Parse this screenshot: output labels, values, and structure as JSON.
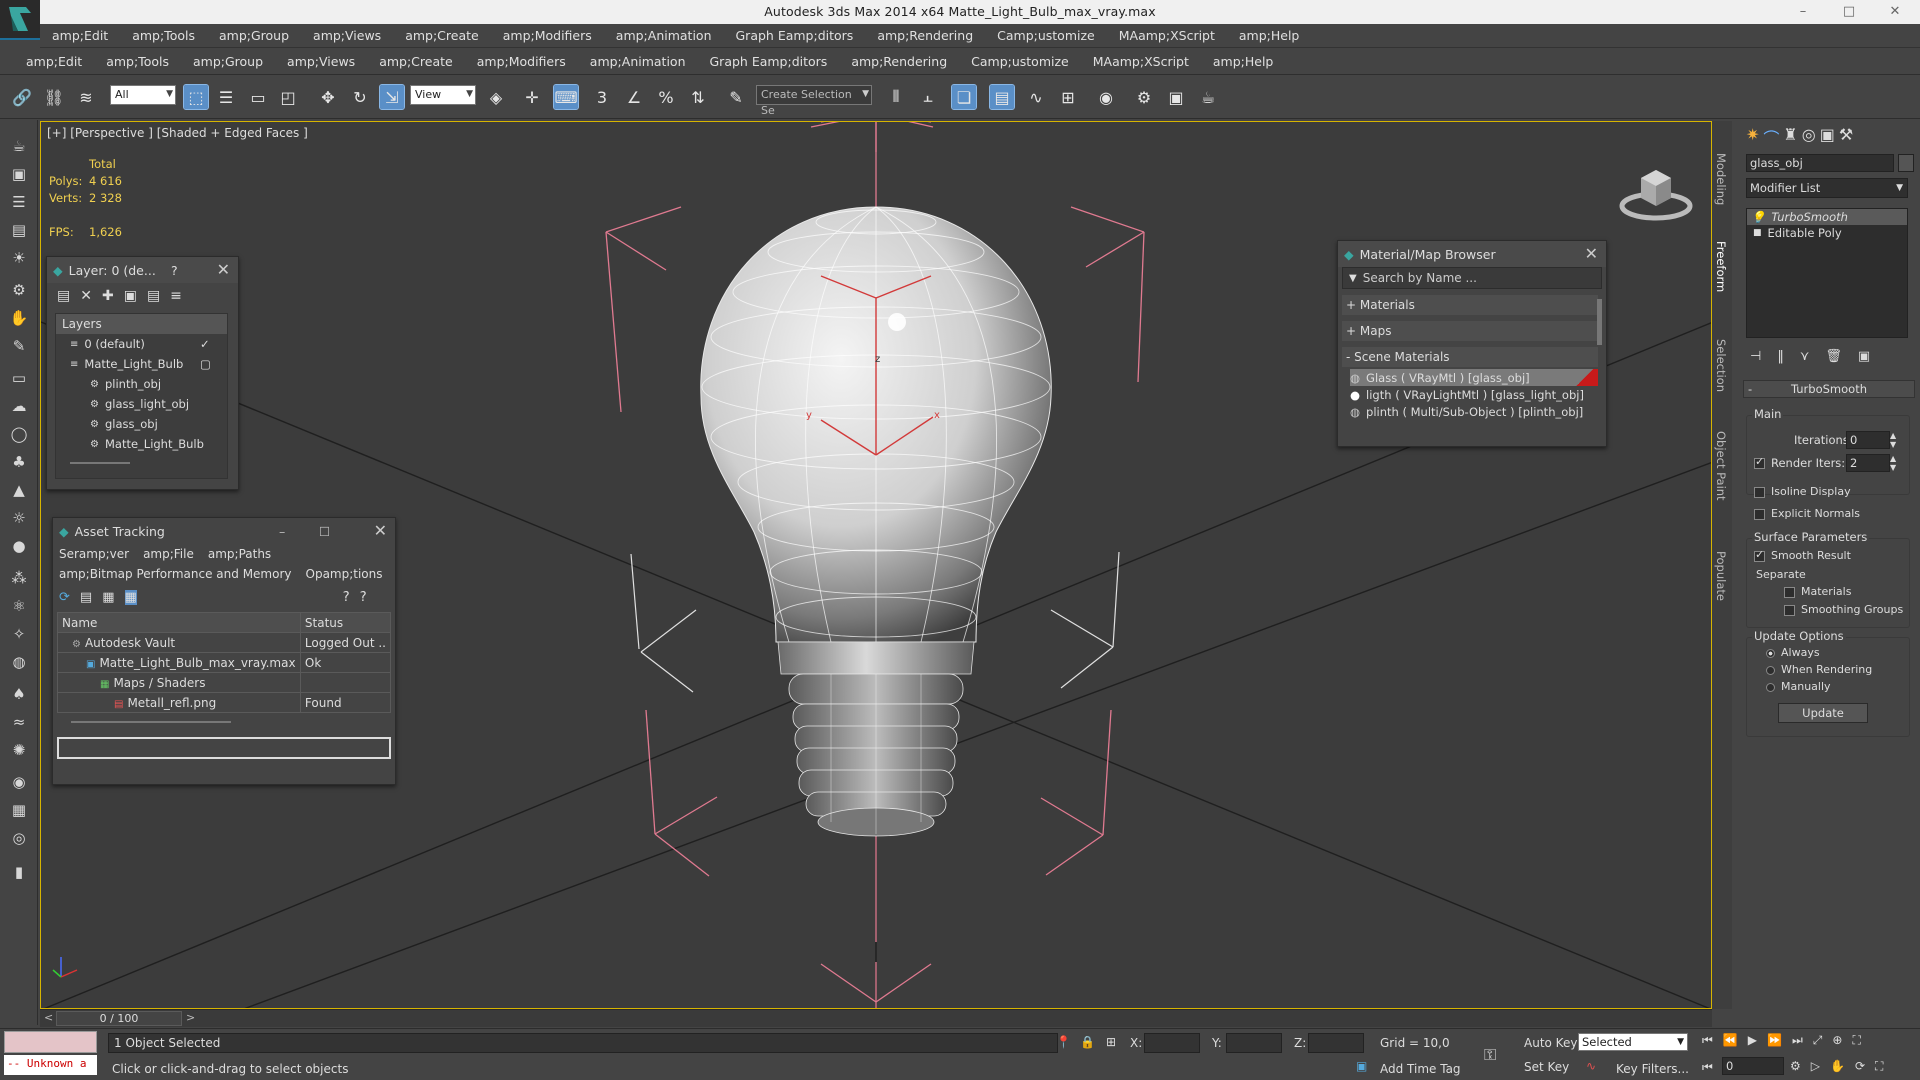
{
  "window": {
    "title": "Autodesk 3ds Max  2014 x64     Matte_Light_Bulb_max_vray.max",
    "controls": [
      "–",
      "□",
      "✕"
    ]
  },
  "menu_primary": [
    "amp;Edit",
    "amp;Tools",
    "amp;Group",
    "amp;Views",
    "amp;Create",
    "amp;Modifiers",
    "amp;Animation",
    "Graph Eamp;ditors",
    "amp;Rendering",
    "Camp;ustomize",
    "MAamp;XScript",
    "amp;Help"
  ],
  "menu_secondary": [
    "amp;Edit",
    "amp;Tools",
    "amp;Group",
    "amp;Views",
    "amp;Create",
    "amp;Modifiers",
    "amp;Animation",
    "Graph Eamp;ditors",
    "amp;Rendering",
    "Camp;ustomize",
    "MAamp;XScript",
    "amp;Help"
  ],
  "toolbar": {
    "filter_value": "All",
    "ref_coord_value": "View",
    "selection_set_placeholder": "Create Selection Se",
    "snap_labels": [
      "3",
      "%"
    ]
  },
  "viewport": {
    "label": "[+] [Perspective ] [Shaded + Edged Faces ]",
    "stats": {
      "header": "Total",
      "polys_label": "Polys:",
      "polys_value": "4 616",
      "verts_label": "Verts:",
      "verts_value": "2 328",
      "fps_label": "FPS:",
      "fps_value": "1,626"
    },
    "axis_labels": {
      "z": "z",
      "x": "x",
      "y": "y"
    }
  },
  "layer_panel": {
    "title": "Layer: 0 (de...",
    "help": "?",
    "header": "Layers",
    "items": [
      {
        "label": "0 (default)",
        "indent": 1
      },
      {
        "label": "Matte_Light_Bulb",
        "indent": 1
      },
      {
        "label": "plinth_obj",
        "indent": 2
      },
      {
        "label": "glass_light_obj",
        "indent": 2
      },
      {
        "label": "glass_obj",
        "indent": 2
      },
      {
        "label": "Matte_Light_Bulb",
        "indent": 2
      }
    ]
  },
  "asset_panel": {
    "title": "Asset Tracking",
    "menu_row1": [
      "Seramp;ver",
      "amp;File",
      "amp;Paths"
    ],
    "menu_row2": [
      "amp;Bitmap Performance and Memory",
      "Opamp;tions"
    ],
    "columns": [
      "Name",
      "Status"
    ],
    "rows": [
      {
        "name": "Autodesk Vault",
        "status": "Logged Out ..",
        "indent": 1
      },
      {
        "name": "Matte_Light_Bulb_max_vray.max",
        "status": "Ok",
        "indent": 2
      },
      {
        "name": "Maps / Shaders",
        "status": "",
        "indent": 3
      },
      {
        "name": "Metall_refl.png",
        "status": "Found",
        "indent": 4
      }
    ]
  },
  "material_panel": {
    "title": "Material/Map Browser",
    "search_placeholder": "Search by Name ...",
    "sections": [
      "+ Materials",
      "+ Maps",
      "- Scene Materials"
    ],
    "materials": [
      "Glass  ( VRayMtl )  [glass_obj]",
      "ligth  ( VRayLightMtl )  [glass_light_obj]",
      "plinth  ( Multi/Sub-Object )  [plinth_obj]"
    ]
  },
  "side_tabs": [
    "Modeling",
    "Freeform",
    "Selection",
    "Object Paint",
    "Populate"
  ],
  "command_panel": {
    "object_name": "glass_obj",
    "modifier_list": "Modifier List",
    "stack": [
      "TurboSmooth",
      "Editable Poly"
    ],
    "rollout_title": "TurboSmooth",
    "main_label": "Main",
    "iterations_label": "Iterations:",
    "iterations_value": "0",
    "render_iters_label": "Render Iters:",
    "render_iters_value": "2",
    "isoline": "Isoline Display",
    "explicit": "Explicit Normals",
    "surface_label": "Surface Parameters",
    "smooth_result": "Smooth Result",
    "separate_label": "Separate",
    "materials": "Materials",
    "smoothing_groups": "Smoothing Groups",
    "update_options": "Update Options",
    "always": "Always",
    "when_rendering": "When Rendering",
    "manually": "Manually",
    "update_button": "Update"
  },
  "timeline": {
    "value": "0 / 100"
  },
  "status": {
    "script_text": "-- Unknown a",
    "selected_text": "1 Object Selected",
    "prompt_text": "Click or click-and-drag to select objects",
    "x_label": "X:",
    "y_label": "Y:",
    "z_label": "Z:",
    "grid": "Grid = 10,0",
    "add_time_tag": "Add Time Tag",
    "auto_key": "Auto Key",
    "set_key": "Set Key",
    "selected_dropdown": "Selected",
    "key_filters": "Key Filters...",
    "frame_value": "0"
  },
  "colors": {
    "viewport_bg": "#3c3c3c",
    "accent_blue": "#5a8fc7",
    "stats_yellow": "#f0d050",
    "selection_red": "#c81a1a"
  }
}
